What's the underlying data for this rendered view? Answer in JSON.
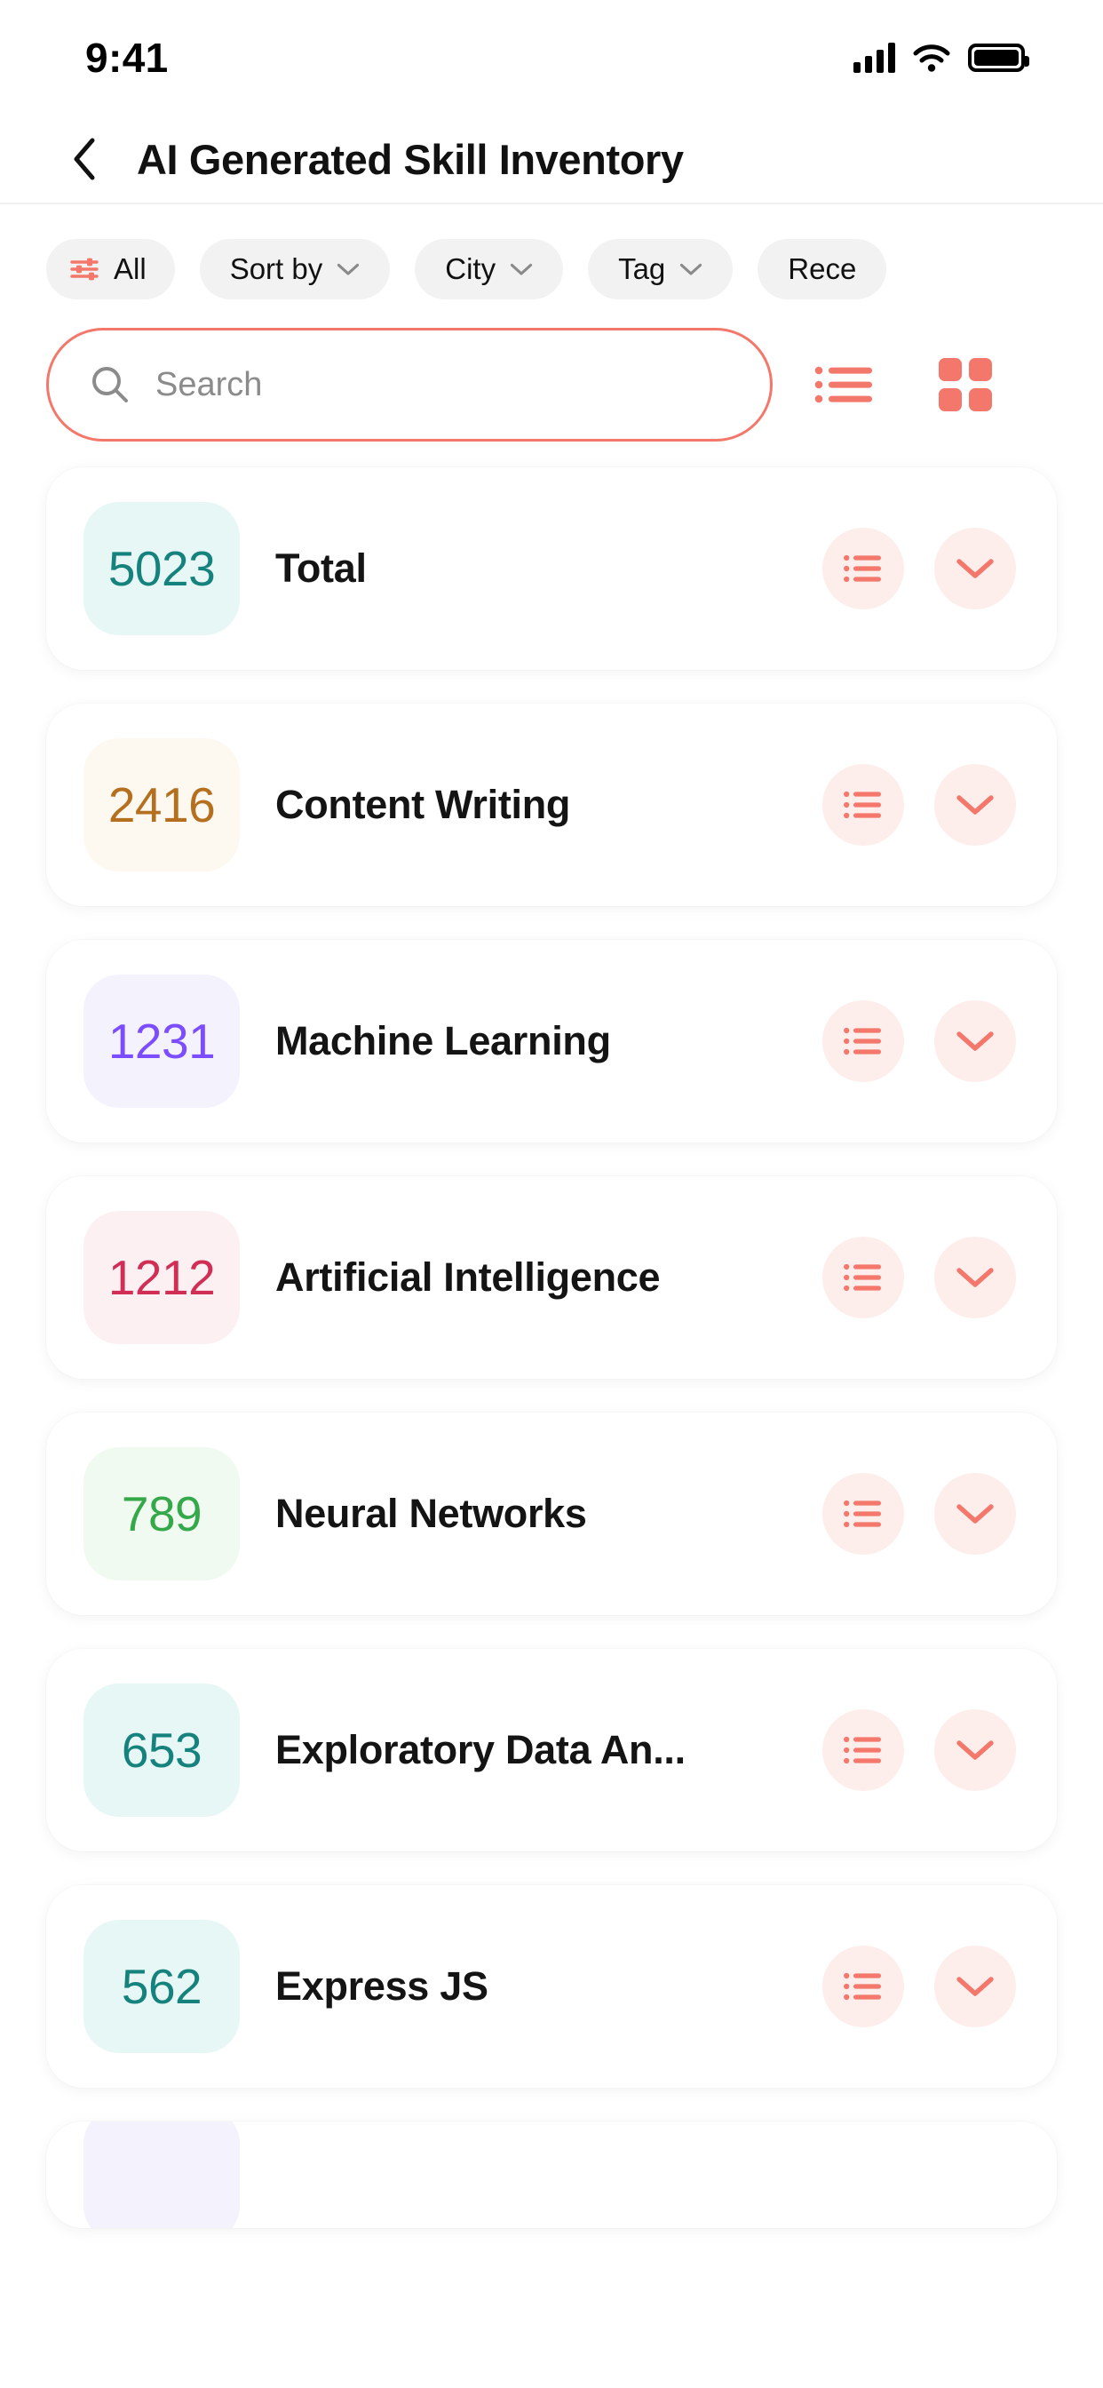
{
  "status_bar": {
    "time": "9:41",
    "icons": [
      "cellular-signal-icon",
      "wifi-icon",
      "battery-icon"
    ]
  },
  "header": {
    "back_icon": "chevron-left-icon",
    "title": "AI Generated Skill Inventory"
  },
  "filters": {
    "chips": [
      {
        "label": "All",
        "icon": "filter-sliders-icon",
        "has_chevron": false
      },
      {
        "label": "Sort by",
        "icon": "",
        "has_chevron": true
      },
      {
        "label": "City",
        "icon": "",
        "has_chevron": true
      },
      {
        "label": "Tag",
        "icon": "",
        "has_chevron": true
      },
      {
        "label": "Rece",
        "icon": "",
        "has_chevron": false
      }
    ]
  },
  "search": {
    "placeholder": "Search",
    "value": "",
    "icon": "search-icon"
  },
  "view_toggle": {
    "list_icon": "list-view-icon",
    "grid_icon": "grid-view-icon",
    "active": "grid"
  },
  "colors": {
    "accent": "#f4776b",
    "accent_soft": "#fdeeec",
    "teal": "#16827d",
    "teal_bg": "#e6f7f5",
    "amber": "#b5701f",
    "amber_bg": "#fdf8f0",
    "purple": "#7c4dff",
    "purple_bg": "#f4f2fd",
    "crimson": "#d02e55",
    "crimson_bg": "#fdf0f3",
    "green": "#35a84a",
    "green_bg": "#f0faf1"
  },
  "skills": [
    {
      "count": "5023",
      "label": "Total",
      "color": "#16827d",
      "bg": "#e6f7f5"
    },
    {
      "count": "2416",
      "label": "Content Writing",
      "color": "#b5701f",
      "bg": "#fdf8f0"
    },
    {
      "count": "1231",
      "label": "Machine Learning",
      "color": "#7c4dff",
      "bg": "#f4f2fd"
    },
    {
      "count": "1212",
      "label": "Artificial Intelligence",
      "color": "#d02e55",
      "bg": "#fdf0f3"
    },
    {
      "count": "789",
      "label": "Neural Networks",
      "color": "#35a84a",
      "bg": "#f0faf1"
    },
    {
      "count": "653",
      "label": "Exploratory Data An...",
      "color": "#16827d",
      "bg": "#e6f7f5"
    },
    {
      "count": "562",
      "label": "Express JS",
      "color": "#16827d",
      "bg": "#e6f7f5"
    },
    {
      "count": "",
      "label": "",
      "color": "#7c4dff",
      "bg": "#f4f2fd"
    }
  ],
  "row_actions": {
    "list_icon": "list-lines-icon",
    "expand_icon": "chevron-down-icon"
  }
}
